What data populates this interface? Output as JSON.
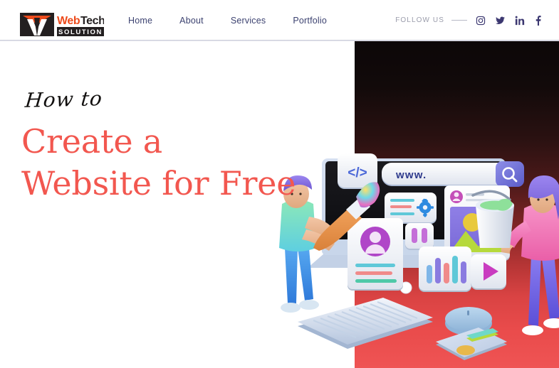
{
  "header": {
    "logo": {
      "name": "webtech-solution-logo",
      "word_one": "Web",
      "word_two": "Tech",
      "tagline": "SOLUTION",
      "color_orange": "#ED4B1C",
      "color_dark": "#231F20"
    },
    "nav": [
      {
        "label": "Home",
        "name": "nav-link-home"
      },
      {
        "label": "About",
        "name": "nav-link-about"
      },
      {
        "label": "Services",
        "name": "nav-link-services"
      },
      {
        "label": "Portfolio",
        "name": "nav-link-portfolio"
      }
    ],
    "follow": {
      "label": "FOLLOW US",
      "icons": [
        {
          "name": "instagram-icon",
          "title": "Instagram"
        },
        {
          "name": "twitter-icon",
          "title": "Twitter"
        },
        {
          "name": "linkedin-icon",
          "title": "LinkedIn"
        },
        {
          "name": "facebook-icon",
          "title": "Facebook"
        }
      ]
    },
    "nav_text_color": "#3C4270",
    "follow_label_color": "#9A9CAB"
  },
  "hero": {
    "kicker": "How to",
    "title_line_1": "Create a",
    "title_line_2": "Website for Free",
    "title_color": "#F2574F",
    "kicker_color": "#12100F",
    "background_color": "#FFFFFF"
  },
  "panel": {
    "name": "illustration-panel",
    "gradient_top": "#0C0708",
    "gradient_mid": "#7D2424",
    "gradient_bottom": "#EF5454"
  },
  "illustration": {
    "description": "3D render of two people building a website around a desktop monitor",
    "browser_card": {
      "url_text": "www.",
      "url_text_color": "#2E3A8C",
      "search_button_color": "#6E6FD6"
    },
    "code_card": {
      "glyph": "</>",
      "color": "#4B68D8"
    },
    "settings_card": {
      "gear_color": "#2E8BE0",
      "line_colors": [
        "#5FC8D8",
        "#F08A8A",
        "#5FC8D8"
      ]
    },
    "post_card": {
      "sky_color": "#8A7BE0",
      "sun_color": "#E8C93C",
      "hill_color": "#B6D93C"
    },
    "profile_card": {
      "avatar_color": "#B046C8",
      "line_colors": [
        "#5FC8D8",
        "#F08A8A",
        "#4FC9A8"
      ]
    },
    "chart_card": {
      "bar_colors": [
        "#7FB6E8",
        "#8A7BE0",
        "#F08A8A",
        "#5FC8D8",
        "#8A7BE0"
      ]
    },
    "play_card": {
      "triangle_color": "#C93CC0"
    },
    "character_left": {
      "hair": "#7B5FD6",
      "shirt": "#76D9A8",
      "pants": "#3B87E0",
      "holding": "paintbrush"
    },
    "character_right": {
      "hair": "#8A6FE0",
      "shirt": "#ED6FB4",
      "pants": "#6A5FE0",
      "holding": "paint-bucket"
    },
    "devices": [
      "monitor",
      "keyboard",
      "mouse",
      "mousepad"
    ]
  }
}
